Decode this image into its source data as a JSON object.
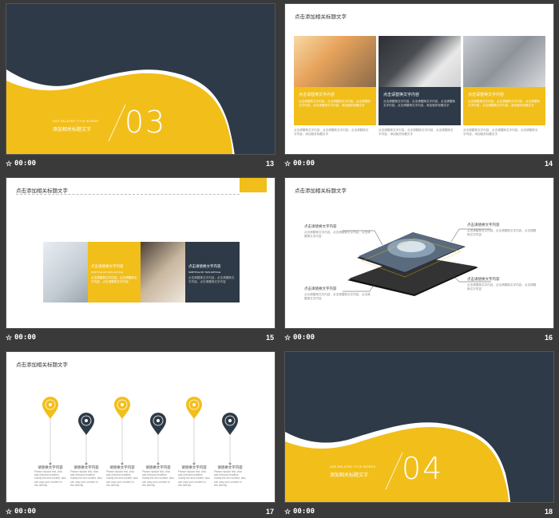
{
  "slides": [
    {
      "num": "13",
      "time": "00:00",
      "en": "ADD RELATED TITLE WORDS",
      "cn": "添加相关标题文字",
      "big": "03"
    },
    {
      "num": "14",
      "time": "00:00",
      "title": "点击添加相关标题文字",
      "boxes": [
        {
          "h": "点击请替换文字内容",
          "t": "点击请替换文字内容，点击请替换文字内容，点击请替换文字内容，点击请替换文字内容，添加相关标题文字"
        },
        {
          "h": "点击请替换文字内容",
          "t": "点击请替换文字内容，点击请替换文字内容，点击请替换文字内容，点击请替换文字内容，添加相关标题文字"
        },
        {
          "h": "点击请替换文字内容",
          "t": "点击请替换文字内容，点击请替换文字内容，点击请替换文字内容，点击请替换文字内容，添加相关标题文字"
        }
      ],
      "foot": "点击请替换文字内容，点击请替换文字内容，点击请替换文字内容，添加相关标题文字"
    },
    {
      "num": "15",
      "time": "00:00",
      "title": "点击添加相关标题文字",
      "p1h": "点击请替换文字内容",
      "p1en": "SUBTITLE OF THIS ARTICLE",
      "p1t": "点击请替换文字内容，点击请替换文字内容，点击请替换文字内容",
      "p2h": "点击请替换文字内容",
      "p2en": "SUBTITLE OF THIS ARTICLE",
      "p2t": "点击请替换文字内容，点击请替换文字内容，点击请替换文字内容"
    },
    {
      "num": "16",
      "time": "00:00",
      "title": "点击添加相关标题文字",
      "callouts": [
        "点击请替换文字内容",
        "点击请替换文字内容",
        "点击请替换文字内容",
        "点击请替换文字内容"
      ],
      "desc": "点击请替换文字内容，点击请替换文字内容，点击请替换文字内容"
    },
    {
      "num": "17",
      "time": "00:00",
      "title": "点击添加相关标题文字",
      "label": "请替换文字内容",
      "desc": "Please replace text, click add relevant headline, modify the text content, also can copy your content to this directly."
    },
    {
      "num": "18",
      "time": "00:00",
      "en": "ADD RELATED TITLE WORDS",
      "cn": "添加相关标题文字",
      "big": "04"
    }
  ],
  "colors": {
    "yellow": "#f2be1a",
    "navy": "#2e3a47",
    "bg": "#3a3a3a"
  }
}
